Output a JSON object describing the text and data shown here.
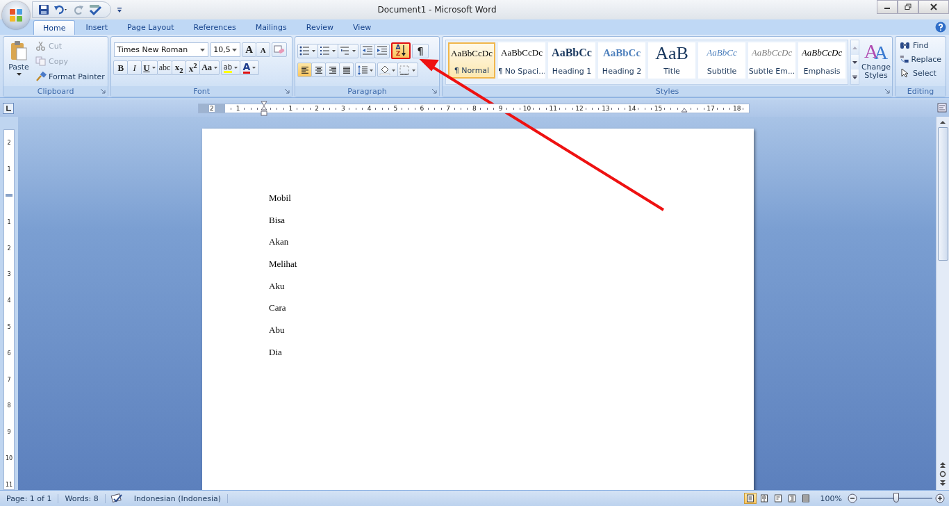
{
  "window": {
    "title": "Document1 - Microsoft Word"
  },
  "tabs": [
    {
      "label": "Home",
      "selected": true
    },
    {
      "label": "Insert",
      "selected": false
    },
    {
      "label": "Page Layout",
      "selected": false
    },
    {
      "label": "References",
      "selected": false
    },
    {
      "label": "Mailings",
      "selected": false
    },
    {
      "label": "Review",
      "selected": false
    },
    {
      "label": "View",
      "selected": false
    }
  ],
  "clipboard": {
    "label": "Clipboard",
    "paste": "Paste",
    "items": [
      {
        "label": "Cut",
        "kind": "cut",
        "disabled": true
      },
      {
        "label": "Copy",
        "kind": "copy",
        "disabled": true
      },
      {
        "label": "Format Painter",
        "kind": "painter",
        "disabled": false
      }
    ]
  },
  "font": {
    "label": "Font",
    "name": "Times New Roman",
    "size": "10,5",
    "grow": "A",
    "shrink": "A",
    "highlight": "ab",
    "color_glyph": "A",
    "formats": [
      {
        "glyph": "B",
        "kind": "bold",
        "dropdown": false
      },
      {
        "glyph": "I",
        "kind": "italic",
        "dropdown": false
      },
      {
        "glyph": "U",
        "kind": "underline",
        "dropdown": true
      },
      {
        "glyph": "abc",
        "kind": "strike",
        "dropdown": false
      },
      {
        "glyph": "x$_{2}$",
        "kind": "sub",
        "dropdown": false
      },
      {
        "glyph": "x$^{2}$",
        "kind": "sup",
        "dropdown": false
      },
      {
        "glyph": "Aa",
        "kind": "case",
        "dropdown": true
      }
    ]
  },
  "paragraph": {
    "label": "Paragraph",
    "sort": {
      "top": "A",
      "bottom": "Z",
      "highlighted": true
    },
    "pilcrow": "¶",
    "alignments": [
      {
        "kind": "left",
        "selected": true
      },
      {
        "kind": "center",
        "selected": false
      },
      {
        "kind": "right",
        "selected": false
      },
      {
        "kind": "justify",
        "selected": false
      }
    ]
  },
  "styles": {
    "label": "Styles",
    "items": [
      {
        "preview": "AaBbCcDc",
        "name": "¶ Normal",
        "kind": "normal",
        "selected": true
      },
      {
        "preview": "AaBbCcDc",
        "name": "¶ No Spaci...",
        "kind": "plain",
        "selected": false
      },
      {
        "preview": "AaBbCc",
        "name": "Heading 1",
        "kind": "heading1",
        "selected": false
      },
      {
        "preview": "AaBbCc",
        "name": "Heading 2",
        "kind": "heading2",
        "selected": false
      },
      {
        "preview": "AaB",
        "name": "Title",
        "kind": "title",
        "selected": false
      },
      {
        "preview": "AaBbCc",
        "name": "Subtitle",
        "kind": "subtitle",
        "selected": false
      },
      {
        "preview": "AaBbCcDc",
        "name": "Subtle Em...",
        "kind": "subtle",
        "selected": false
      },
      {
        "preview": "AaBbCcDc",
        "name": "Emphasis",
        "kind": "emphasis",
        "selected": false
      }
    ],
    "change_styles": {
      "label": "Change Styles",
      "glyphs": [
        "A",
        "A"
      ]
    }
  },
  "editing": {
    "label": "Editing",
    "items": [
      {
        "label": "Find",
        "kind": "find"
      },
      {
        "label": "Replace",
        "kind": "replace"
      },
      {
        "label": "Select",
        "kind": "select"
      }
    ]
  },
  "ruler": [
    {
      "kind": "number",
      "label": "2"
    },
    {
      "kind": "number",
      "label": "1"
    },
    {
      "kind": "indent"
    },
    {
      "kind": "number",
      "label": "1"
    },
    {
      "kind": "number",
      "label": "2"
    },
    {
      "kind": "number",
      "label": "3"
    },
    {
      "kind": "number",
      "label": "4"
    },
    {
      "kind": "number",
      "label": "5"
    },
    {
      "kind": "number",
      "label": "6"
    },
    {
      "kind": "number",
      "label": "7"
    },
    {
      "kind": "number",
      "label": "8"
    },
    {
      "kind": "number",
      "label": "9"
    },
    {
      "kind": "number",
      "label": "10"
    },
    {
      "kind": "number",
      "label": "11"
    },
    {
      "kind": "number",
      "label": "12"
    },
    {
      "kind": "number",
      "label": "13"
    },
    {
      "kind": "number",
      "label": "14"
    },
    {
      "kind": "number",
      "label": "15"
    },
    {
      "kind": "right-indent"
    },
    {
      "kind": "number",
      "label": "17"
    },
    {
      "kind": "number",
      "label": "18"
    }
  ],
  "vertical_ruler": [
    {
      "kind": "number",
      "label": "2"
    },
    {
      "kind": "number",
      "label": "1"
    },
    {
      "kind": "margin"
    },
    {
      "kind": "number",
      "label": "1"
    },
    {
      "kind": "number",
      "label": "2"
    },
    {
      "kind": "number",
      "label": "3"
    },
    {
      "kind": "number",
      "label": "4"
    },
    {
      "kind": "number",
      "label": "5"
    },
    {
      "kind": "number",
      "label": "6"
    },
    {
      "kind": "number",
      "label": "7"
    },
    {
      "kind": "number",
      "label": "8"
    },
    {
      "kind": "number",
      "label": "9"
    },
    {
      "kind": "number",
      "label": "10"
    },
    {
      "kind": "number",
      "label": "11"
    }
  ],
  "document": {
    "lines": [
      "Mobil",
      "Bisa",
      "Akan",
      "Melihat",
      "Aku",
      "Cara",
      "Abu",
      "Dia"
    ]
  },
  "status_bar": {
    "page": "Page: 1 of 1",
    "words": "Words: 8",
    "language": "Indonesian (Indonesia)",
    "zoom": "100%",
    "zoom_slider": {
      "level": 0.5
    },
    "views": [
      {
        "kind": "print",
        "selected": true
      },
      {
        "kind": "reading",
        "selected": false
      },
      {
        "kind": "web",
        "selected": false
      },
      {
        "kind": "outline",
        "selected": false
      },
      {
        "kind": "draft",
        "selected": false
      }
    ]
  }
}
